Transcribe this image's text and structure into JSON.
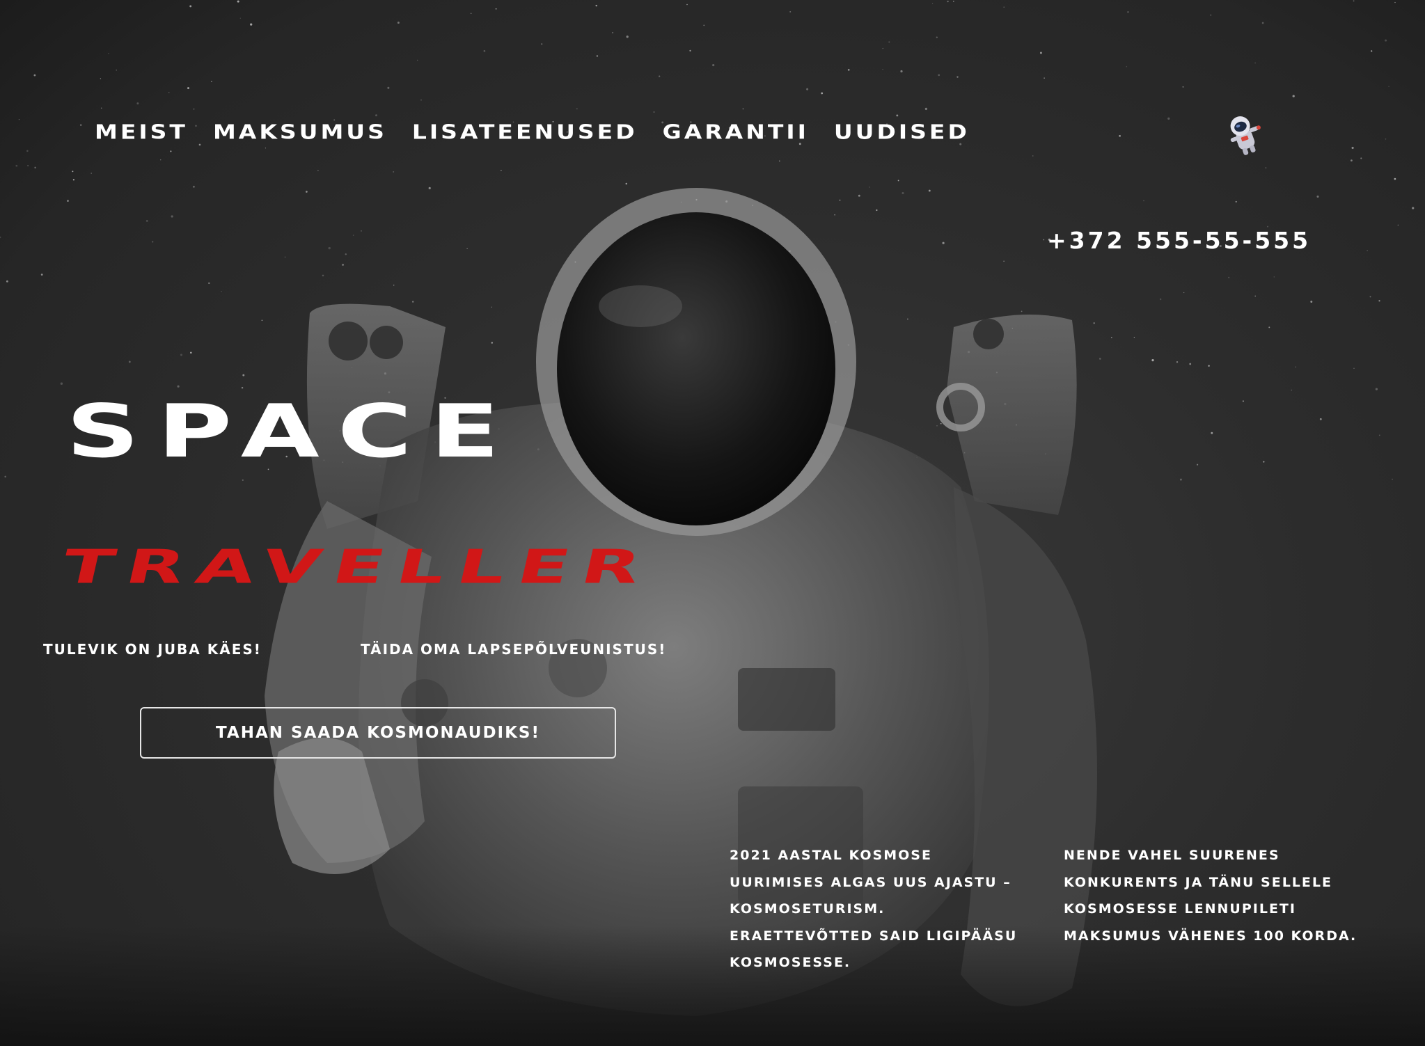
{
  "nav": {
    "items": [
      {
        "label": "MEIST"
      },
      {
        "label": "MAKSUMUS"
      },
      {
        "label": "LISATEENUSED"
      },
      {
        "label": "GARANTII"
      },
      {
        "label": "UUDISED"
      }
    ]
  },
  "header": {
    "phone": "+372 555-55-555",
    "mascot_icon": "astronaut-icon"
  },
  "hero": {
    "title_line1": "SPACE",
    "title_line2": "TRAVELLER",
    "tagline_1": "TULEVIK ON JUBA KÄES!",
    "tagline_2": "TÄIDA OMA LAPSEPÕLVEUNISTUS!",
    "cta_label": "TAHAN SAADA KOSMONAUDIKS!"
  },
  "info": {
    "column_1": "2021 AASTAL KOSMOSE UURIMISES ALGAS UUS AJASTU – KOSMOSETURISM. ERAETTEVÕTTED SAID LIGIPÄÄSU KOSMOSESSE.",
    "column_2": "NENDE VAHEL SUURENES KONKURENTS JA TÄNU SELLELE KOSMOSESSE LENNUPILETI MAKSUMUS VÄHENES 100 KORDA."
  },
  "colors": {
    "background": "#2b2b2b",
    "accent_red": "#d11717",
    "text": "#ffffff"
  }
}
